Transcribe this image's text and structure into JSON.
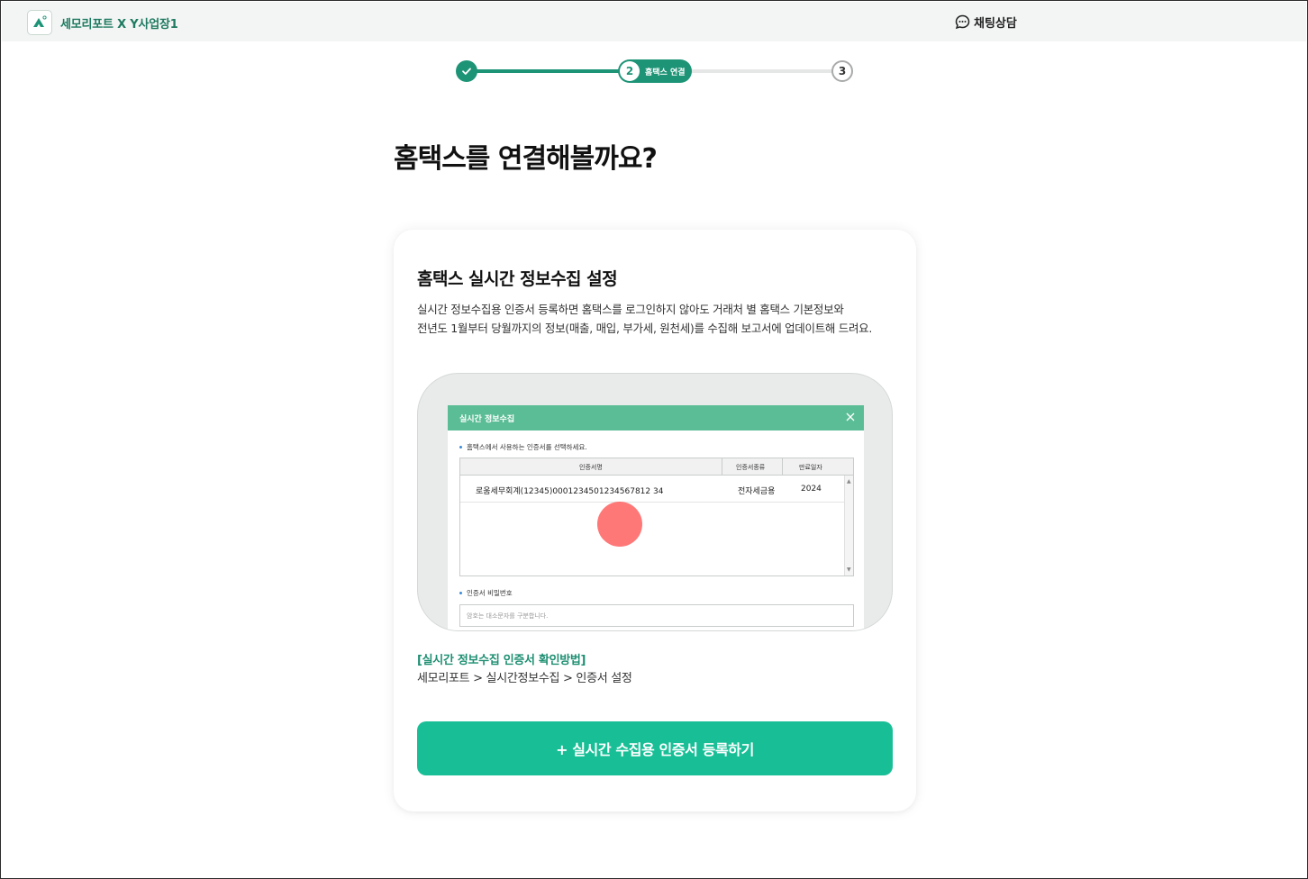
{
  "header": {
    "brand_name": "세모리포트 X Y사업장1",
    "chat_label": "채팅상담"
  },
  "stepper": {
    "steps": [
      {
        "number": "",
        "status": "done"
      },
      {
        "number": "2",
        "label": "홈택스 연결",
        "status": "active"
      },
      {
        "number": "3",
        "status": "todo"
      }
    ]
  },
  "page": {
    "title": "홈택스를 연결해볼까요?"
  },
  "card": {
    "title": "홈택스 실시간 정보수집 설정",
    "description_line1": "실시간 정보수집용 인증서 등록하면 홈택스를 로그인하지 않아도 거래처 별 홈택스 기본정보와",
    "description_line2": "전년도 1월부터 당월까지의 정보(매출, 매입, 부가세, 원천세)를 수집해 보고서에 업데이트해 드려요.",
    "preview": {
      "dialog_title": "실시간 정보수집",
      "select_label": "홈택스에서 사용하는 인증서를 선택하세요.",
      "columns": [
        "인증서명",
        "인증서종류",
        "만료일자"
      ],
      "rows": [
        {
          "name": "로움세무회계(12345)0001234501234567812 34",
          "type": "전자세금용",
          "expiry": "2024"
        }
      ],
      "password_label": "인증서 비밀번호",
      "password_placeholder": "암호는 대소문자를 구분합니다."
    },
    "guide_link": "[실시간 정보수집 인증서 확인방법]",
    "guide_path": "세모리포트 > 실시간정보수집 > 인증서 설정",
    "cta_label": "+ 실시간 수집용 인증서 등록하기"
  },
  "colors": {
    "accent": "#1e9477",
    "cta": "#18bf96",
    "header_bg": "#f3f5f4",
    "dialog_head": "#5bbd96"
  }
}
